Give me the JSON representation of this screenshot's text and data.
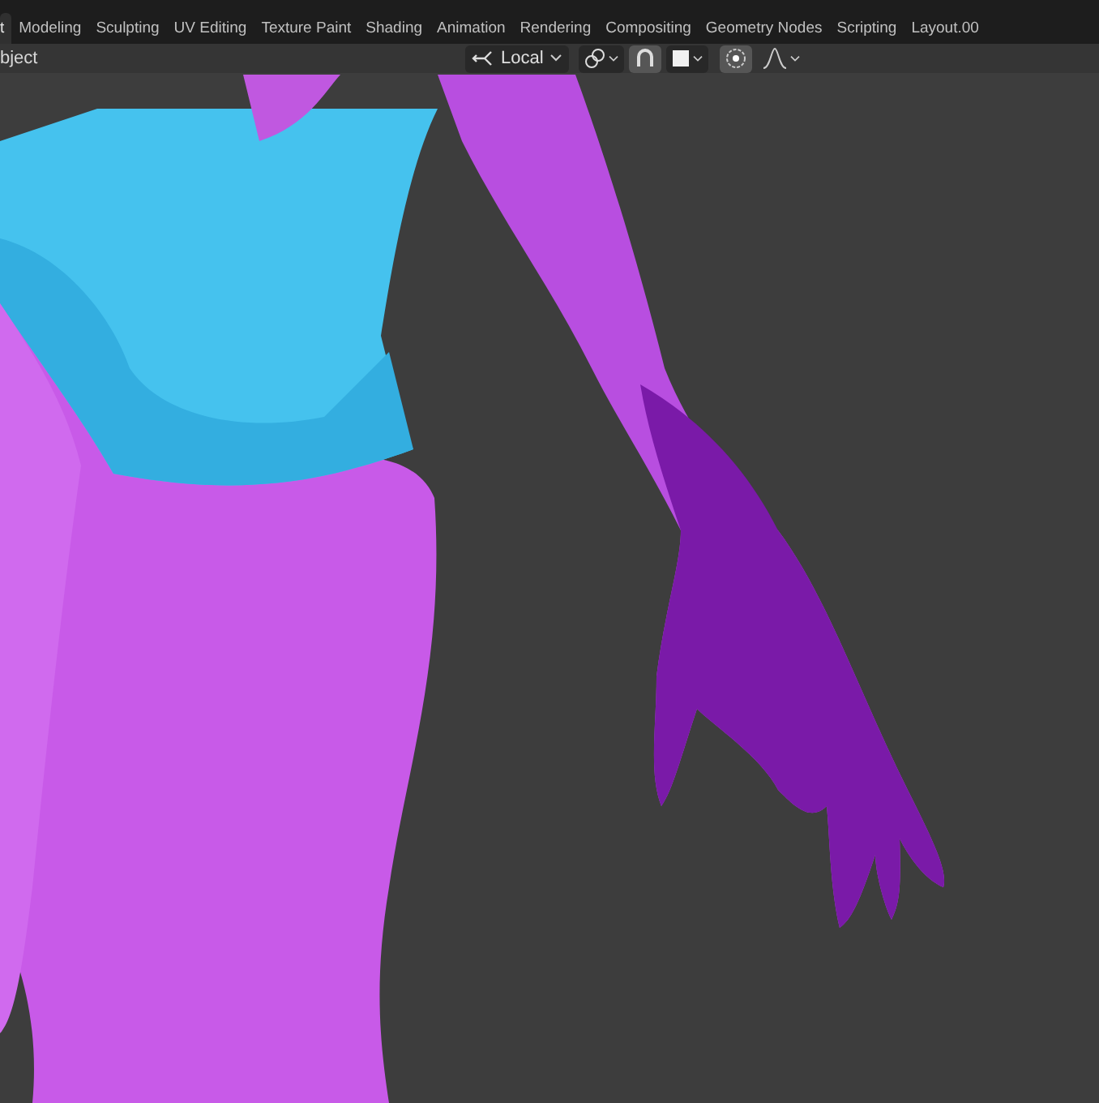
{
  "workspace_tabs": [
    {
      "label": "t",
      "selected": true
    },
    {
      "label": "Modeling",
      "selected": false
    },
    {
      "label": "Sculpting",
      "selected": false
    },
    {
      "label": "UV Editing",
      "selected": false
    },
    {
      "label": "Texture Paint",
      "selected": false
    },
    {
      "label": "Shading",
      "selected": false
    },
    {
      "label": "Animation",
      "selected": false
    },
    {
      "label": "Rendering",
      "selected": false
    },
    {
      "label": "Compositing",
      "selected": false
    },
    {
      "label": "Geometry Nodes",
      "selected": false
    },
    {
      "label": "Scripting",
      "selected": false
    },
    {
      "label": "Layout.00",
      "selected": false
    }
  ],
  "header": {
    "mode": "bject",
    "transform_orientation": "Local",
    "snap": {
      "on": true
    },
    "proportional_editing": {
      "on": true
    }
  }
}
